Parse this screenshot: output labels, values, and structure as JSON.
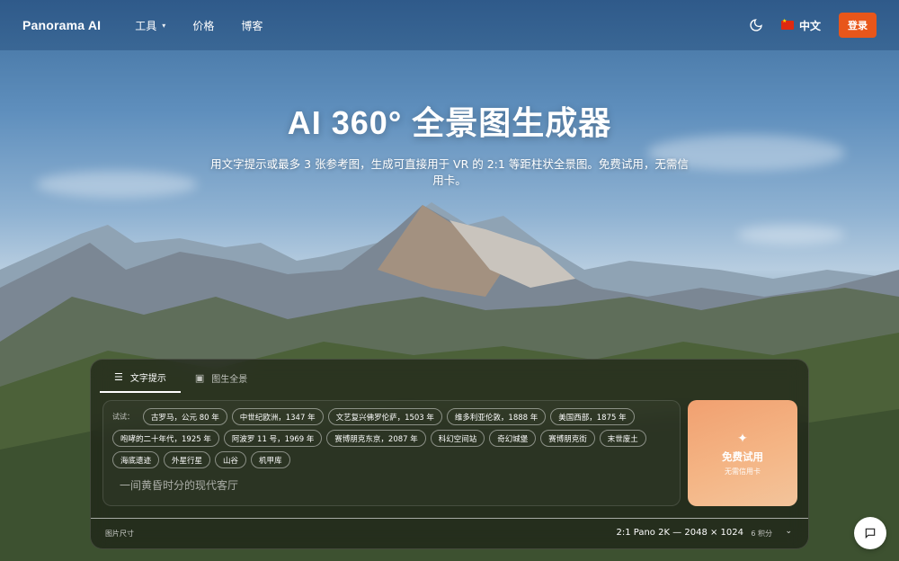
{
  "header": {
    "logo": "Panorama AI",
    "nav": [
      {
        "label": "工具"
      },
      {
        "label": "价格"
      },
      {
        "label": "博客"
      }
    ],
    "language": "中文",
    "login_label": "登录"
  },
  "hero": {
    "title": "AI 360° 全景图生成器",
    "subtitle": "用文字提示或最多 3 张参考图，生成可直接用于 VR 的 2:1 等距柱状全景图。免费试用，无需信用卡。"
  },
  "generator": {
    "tabs": [
      {
        "label": "文字提示",
        "icon": "text-lines-icon",
        "active": true
      },
      {
        "label": "图生全景",
        "icon": "image-sparkle-icon",
        "active": false
      }
    ],
    "try_label": "试试：",
    "suggestions": [
      "古罗马，公元 80 年",
      "中世纪欧洲，1347 年",
      "文艺复兴佛罗伦萨，1503 年",
      "维多利亚伦敦，1888 年",
      "美国西部，1875 年",
      "咆哮的二十年代，1925 年",
      "阿波罗 11 号，1969 年",
      "赛博朋克东京，2087 年",
      "科幻空间站",
      "奇幻城堡",
      "赛博朋克街",
      "末世废土",
      "海底遗迹",
      "外星行星",
      "山谷",
      "机甲库"
    ],
    "placeholder": "一间黄昏时分的现代客厅",
    "cta_label": "免费试用",
    "cta_sub": "无需信用卡",
    "size_label": "图片尺寸",
    "size_value": "2:1 Pano 2K — 2048 × 1024",
    "credits": "6 积分"
  },
  "colors": {
    "accent": "#e8561a",
    "cta_gradient_start": "#f1a070",
    "cta_gradient_end": "#f3c49b"
  }
}
